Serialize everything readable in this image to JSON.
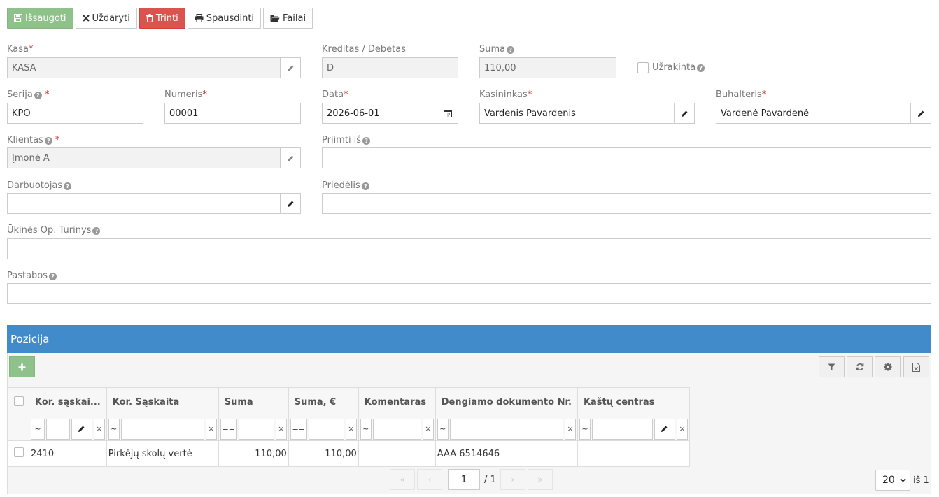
{
  "toolbar": {
    "save_label": "Išsaugoti",
    "close_label": "Uždaryti",
    "delete_label": "Trinti",
    "print_label": "Spausdinti",
    "files_label": "Failai"
  },
  "form": {
    "kasa": {
      "label": "Kasa",
      "required": "*",
      "value": "KASA"
    },
    "kreditas_debetas": {
      "label": "Kreditas / Debetas",
      "value": "D"
    },
    "suma": {
      "label": "Suma",
      "value": "110,00"
    },
    "uzrakinta": {
      "label": "Užrakinta"
    },
    "serija": {
      "label": "Serija",
      "required": "*",
      "value": "KPO"
    },
    "numeris": {
      "label": "Numeris",
      "required": "*",
      "value": "00001"
    },
    "data": {
      "label": "Data",
      "required": "*",
      "value": "2026-06-01"
    },
    "kasininkas": {
      "label": "Kasininkas",
      "required": "*",
      "value": "Vardenis Pavardenis"
    },
    "buhalteris": {
      "label": "Buhalteris",
      "required": "*",
      "value": "Vardenė Pavardenė"
    },
    "klientas": {
      "label": "Klientas",
      "required": "*",
      "value": "Įmonė A"
    },
    "priimti_is": {
      "label": "Priimti iš",
      "value": ""
    },
    "darbuotojas": {
      "label": "Darbuotojas",
      "value": ""
    },
    "priedelis": {
      "label": "Priedėlis",
      "value": ""
    },
    "ukines_op": {
      "label": "Ūkinės Op. Turinys",
      "value": ""
    },
    "pastabos": {
      "label": "Pastabos",
      "value": ""
    }
  },
  "panel": {
    "title": "Pozicija",
    "columns": [
      "Kor. sąskai...",
      "Kor. Sąskaita",
      "Suma",
      "Suma, €",
      "Komentaras",
      "Dengiamo dokumento Nr.",
      "Kaštų centras"
    ],
    "filter_ops": [
      "~",
      "~",
      "==",
      "==",
      "~",
      "~",
      "~"
    ],
    "filter_clear": "×",
    "rows": [
      {
        "kor_sask": "2410",
        "kor_saskaita": "Pirkėjų skolų vertė",
        "suma": "110,00",
        "suma_eur": "110,00",
        "komentaras": "",
        "dengiamo_nr": "AAA 6514646",
        "kastu_centras": ""
      }
    ],
    "pager": {
      "first": "«",
      "prev": "‹",
      "page": "1",
      "total": "/ 1",
      "next": "›",
      "last": "»",
      "page_size": "20",
      "of_label": "iš 1"
    }
  },
  "colors": {
    "green": "#8fc28a",
    "red": "#d9534f",
    "blue": "#428bca",
    "required": "#c9302c"
  }
}
